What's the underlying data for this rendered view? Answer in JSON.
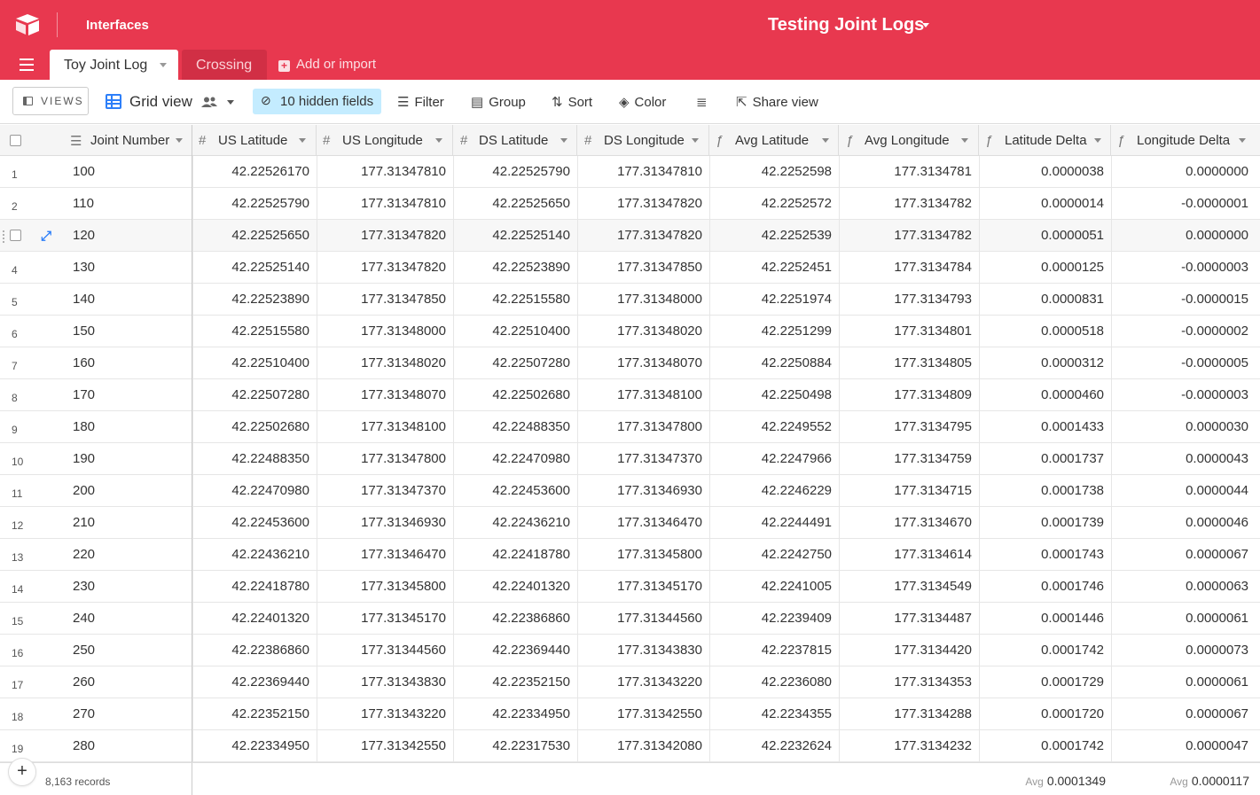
{
  "app": {
    "interfaces_label": "Interfaces",
    "base_title": "Testing Joint Logs"
  },
  "tabs": {
    "active": "Toy Joint Log",
    "inactive": "Crossing",
    "add_import": "Add or import"
  },
  "toolbar": {
    "views_label": "VIEWS",
    "grid_view_label": "Grid view",
    "hidden_fields_label": "10 hidden fields",
    "filter_label": "Filter",
    "group_label": "Group",
    "sort_label": "Sort",
    "color_label": "Color",
    "share_label": "Share view"
  },
  "columns": [
    {
      "label": "Joint Number",
      "icon": "long-text-icon"
    },
    {
      "label": "US Latitude",
      "icon": "number-icon"
    },
    {
      "label": "US Longitude",
      "icon": "number-icon"
    },
    {
      "label": "DS Latitude",
      "icon": "number-icon"
    },
    {
      "label": "DS Longitude",
      "icon": "number-icon"
    },
    {
      "label": "Avg Latitude",
      "icon": "formula-icon"
    },
    {
      "label": "Avg Longitude",
      "icon": "formula-icon"
    },
    {
      "label": "Latitude Delta",
      "icon": "formula-icon"
    },
    {
      "label": "Longitude Delta",
      "icon": "formula-icon"
    }
  ],
  "rows": [
    {
      "n": "1",
      "cells": [
        "100",
        "42.22526170",
        "177.31347810",
        "42.22525790",
        "177.31347810",
        "42.2252598",
        "177.3134781",
        "0.0000038",
        "0.0000000"
      ]
    },
    {
      "n": "2",
      "cells": [
        "110",
        "42.22525790",
        "177.31347810",
        "42.22525650",
        "177.31347820",
        "42.2252572",
        "177.3134782",
        "0.0000014",
        "-0.0000001"
      ]
    },
    {
      "n": "",
      "cells": [
        "120",
        "42.22525650",
        "177.31347820",
        "42.22525140",
        "177.31347820",
        "42.2252539",
        "177.3134782",
        "0.0000051",
        "0.0000000"
      ]
    },
    {
      "n": "4",
      "cells": [
        "130",
        "42.22525140",
        "177.31347820",
        "42.22523890",
        "177.31347850",
        "42.2252451",
        "177.3134784",
        "0.0000125",
        "-0.0000003"
      ]
    },
    {
      "n": "5",
      "cells": [
        "140",
        "42.22523890",
        "177.31347850",
        "42.22515580",
        "177.31348000",
        "42.2251974",
        "177.3134793",
        "0.0000831",
        "-0.0000015"
      ]
    },
    {
      "n": "6",
      "cells": [
        "150",
        "42.22515580",
        "177.31348000",
        "42.22510400",
        "177.31348020",
        "42.2251299",
        "177.3134801",
        "0.0000518",
        "-0.0000002"
      ]
    },
    {
      "n": "7",
      "cells": [
        "160",
        "42.22510400",
        "177.31348020",
        "42.22507280",
        "177.31348070",
        "42.2250884",
        "177.3134805",
        "0.0000312",
        "-0.0000005"
      ]
    },
    {
      "n": "8",
      "cells": [
        "170",
        "42.22507280",
        "177.31348070",
        "42.22502680",
        "177.31348100",
        "42.2250498",
        "177.3134809",
        "0.0000460",
        "-0.0000003"
      ]
    },
    {
      "n": "9",
      "cells": [
        "180",
        "42.22502680",
        "177.31348100",
        "42.22488350",
        "177.31347800",
        "42.2249552",
        "177.3134795",
        "0.0001433",
        "0.0000030"
      ]
    },
    {
      "n": "10",
      "cells": [
        "190",
        "42.22488350",
        "177.31347800",
        "42.22470980",
        "177.31347370",
        "42.2247966",
        "177.3134759",
        "0.0001737",
        "0.0000043"
      ]
    },
    {
      "n": "11",
      "cells": [
        "200",
        "42.22470980",
        "177.31347370",
        "42.22453600",
        "177.31346930",
        "42.2246229",
        "177.3134715",
        "0.0001738",
        "0.0000044"
      ]
    },
    {
      "n": "12",
      "cells": [
        "210",
        "42.22453600",
        "177.31346930",
        "42.22436210",
        "177.31346470",
        "42.2244491",
        "177.3134670",
        "0.0001739",
        "0.0000046"
      ]
    },
    {
      "n": "13",
      "cells": [
        "220",
        "42.22436210",
        "177.31346470",
        "42.22418780",
        "177.31345800",
        "42.2242750",
        "177.3134614",
        "0.0001743",
        "0.0000067"
      ]
    },
    {
      "n": "14",
      "cells": [
        "230",
        "42.22418780",
        "177.31345800",
        "42.22401320",
        "177.31345170",
        "42.2241005",
        "177.3134549",
        "0.0001746",
        "0.0000063"
      ]
    },
    {
      "n": "15",
      "cells": [
        "240",
        "42.22401320",
        "177.31345170",
        "42.22386860",
        "177.31344560",
        "42.2239409",
        "177.3134487",
        "0.0001446",
        "0.0000061"
      ]
    },
    {
      "n": "16",
      "cells": [
        "250",
        "42.22386860",
        "177.31344560",
        "42.22369440",
        "177.31343830",
        "42.2237815",
        "177.3134420",
        "0.0001742",
        "0.0000073"
      ]
    },
    {
      "n": "17",
      "cells": [
        "260",
        "42.22369440",
        "177.31343830",
        "42.22352150",
        "177.31343220",
        "42.2236080",
        "177.3134353",
        "0.0001729",
        "0.0000061"
      ]
    },
    {
      "n": "18",
      "cells": [
        "270",
        "42.22352150",
        "177.31343220",
        "42.22334950",
        "177.31342550",
        "42.2234355",
        "177.3134288",
        "0.0001720",
        "0.0000067"
      ]
    },
    {
      "n": "19",
      "cells": [
        "280",
        "42.22334950",
        "177.31342550",
        "42.22317530",
        "177.31342080",
        "42.2232624",
        "177.3134232",
        "0.0001742",
        "0.0000047"
      ]
    }
  ],
  "footer": {
    "record_count": "8,163 records",
    "agg_label": "Avg",
    "lat_delta_avg": "0.0001349",
    "lon_delta_avg": "0.0000117"
  },
  "colors": {
    "brand": "#e8384f",
    "accent": "#2d7ff9",
    "hidden_fields_bg": "#c4ecff"
  }
}
